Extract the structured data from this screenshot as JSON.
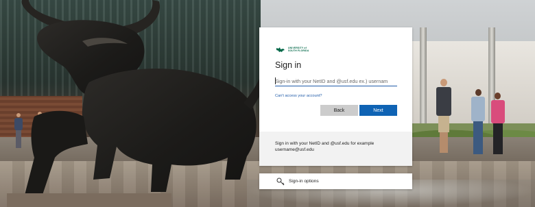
{
  "branding": {
    "logo_line1": "UNIVERSITY of",
    "logo_line2": "SOUTH FLORIDA",
    "brand_color": "#006747"
  },
  "signin": {
    "title": "Sign in",
    "input_value": "",
    "input_placeholder": "Sign-in with your NetID and @usf.edu ex.) usernam",
    "forgot_link": "Can't access your account?",
    "back_label": "Back",
    "next_label": "Next",
    "accent_color": "#0f63b4"
  },
  "info": {
    "text": "Sign in with your NetID and @usf.edu for example username@usf.edu"
  },
  "options": {
    "label": "Sign-in options",
    "icon": "key-icon"
  }
}
